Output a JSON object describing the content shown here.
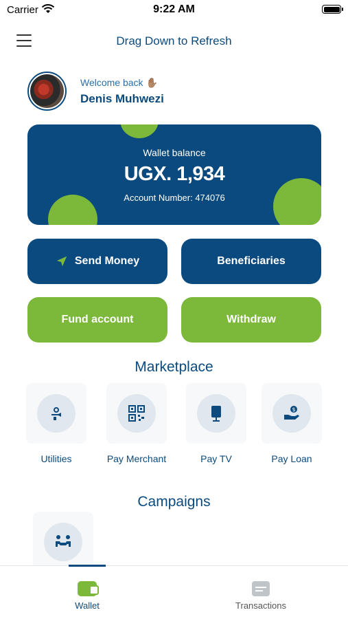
{
  "status_bar": {
    "carrier": "Carrier",
    "time": "9:22 AM"
  },
  "header": {
    "title": "Drag Down to Refresh"
  },
  "profile": {
    "welcome": "Welcome back ✋🏽",
    "name": "Denis Muhwezi"
  },
  "wallet": {
    "label": "Wallet balance",
    "amount": "UGX. 1,934",
    "account_number": "Account Number: 474076"
  },
  "actions": {
    "send_money": "Send Money",
    "beneficiaries": "Beneficiaries",
    "fund_account": "Fund account",
    "withdraw": "Withdraw"
  },
  "marketplace": {
    "title": "Marketplace",
    "items": [
      {
        "label": "Utilities",
        "icon": "utilities-icon"
      },
      {
        "label": "Pay Merchant",
        "icon": "qr-code-icon"
      },
      {
        "label": "Pay TV",
        "icon": "tv-icon"
      },
      {
        "label": "Pay Loan",
        "icon": "loan-hand-icon"
      }
    ]
  },
  "campaigns": {
    "title": "Campaigns",
    "items": [
      {
        "icon": "meeting-icon"
      }
    ]
  },
  "bottom_nav": {
    "wallet": "Wallet",
    "transactions": "Transactions"
  },
  "colors": {
    "primary": "#0b4a7e",
    "accent": "#7cb83a",
    "tile_bg": "#f6f8fa"
  }
}
